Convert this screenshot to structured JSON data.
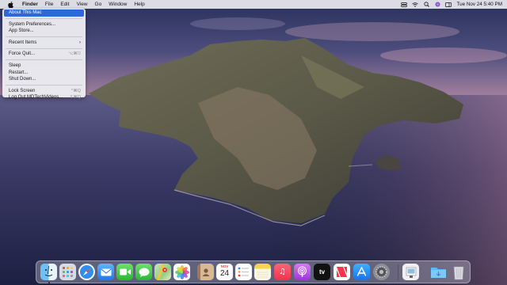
{
  "menubar": {
    "items": [
      "Finder",
      "File",
      "Edit",
      "View",
      "Go",
      "Window",
      "Help"
    ],
    "clock": "Tue Nov 24  5:40 PM",
    "status_icons": [
      "control-center-icon",
      "wifi-icon",
      "spotlight-icon",
      "siri-icon",
      "notification-icon"
    ]
  },
  "apple_menu": {
    "about": "About This Mac",
    "system_prefs": "System Preferences...",
    "app_store": "App Store...",
    "recent_items": "Recent Items",
    "force_quit": "Force Quit...",
    "force_quit_shortcut": "⌥⌘⎋",
    "sleep": "Sleep",
    "restart": "Restart...",
    "shutdown": "Shut Down...",
    "lock_screen": "Lock Screen",
    "lock_screen_shortcut": "^⌘Q",
    "logout": "Log Out MDTechVideos...",
    "logout_shortcut": "⇧⌘Q"
  },
  "dock": {
    "calendar_month": "NOV",
    "calendar_day": "24",
    "apple_tv_label": "tv",
    "apps": [
      "Finder",
      "Launchpad",
      "Safari",
      "Mail",
      "FaceTime",
      "Messages",
      "Maps",
      "Photos",
      "Contacts",
      "Calendar",
      "Reminders",
      "Notes",
      "Music",
      "Podcasts",
      "TV",
      "News",
      "App Store",
      "System Preferences",
      "Preview",
      "Downloads",
      "Trash"
    ]
  },
  "colors": {
    "menu_highlight": "#2c68d6",
    "menubar_bg": "#ebebf0"
  }
}
